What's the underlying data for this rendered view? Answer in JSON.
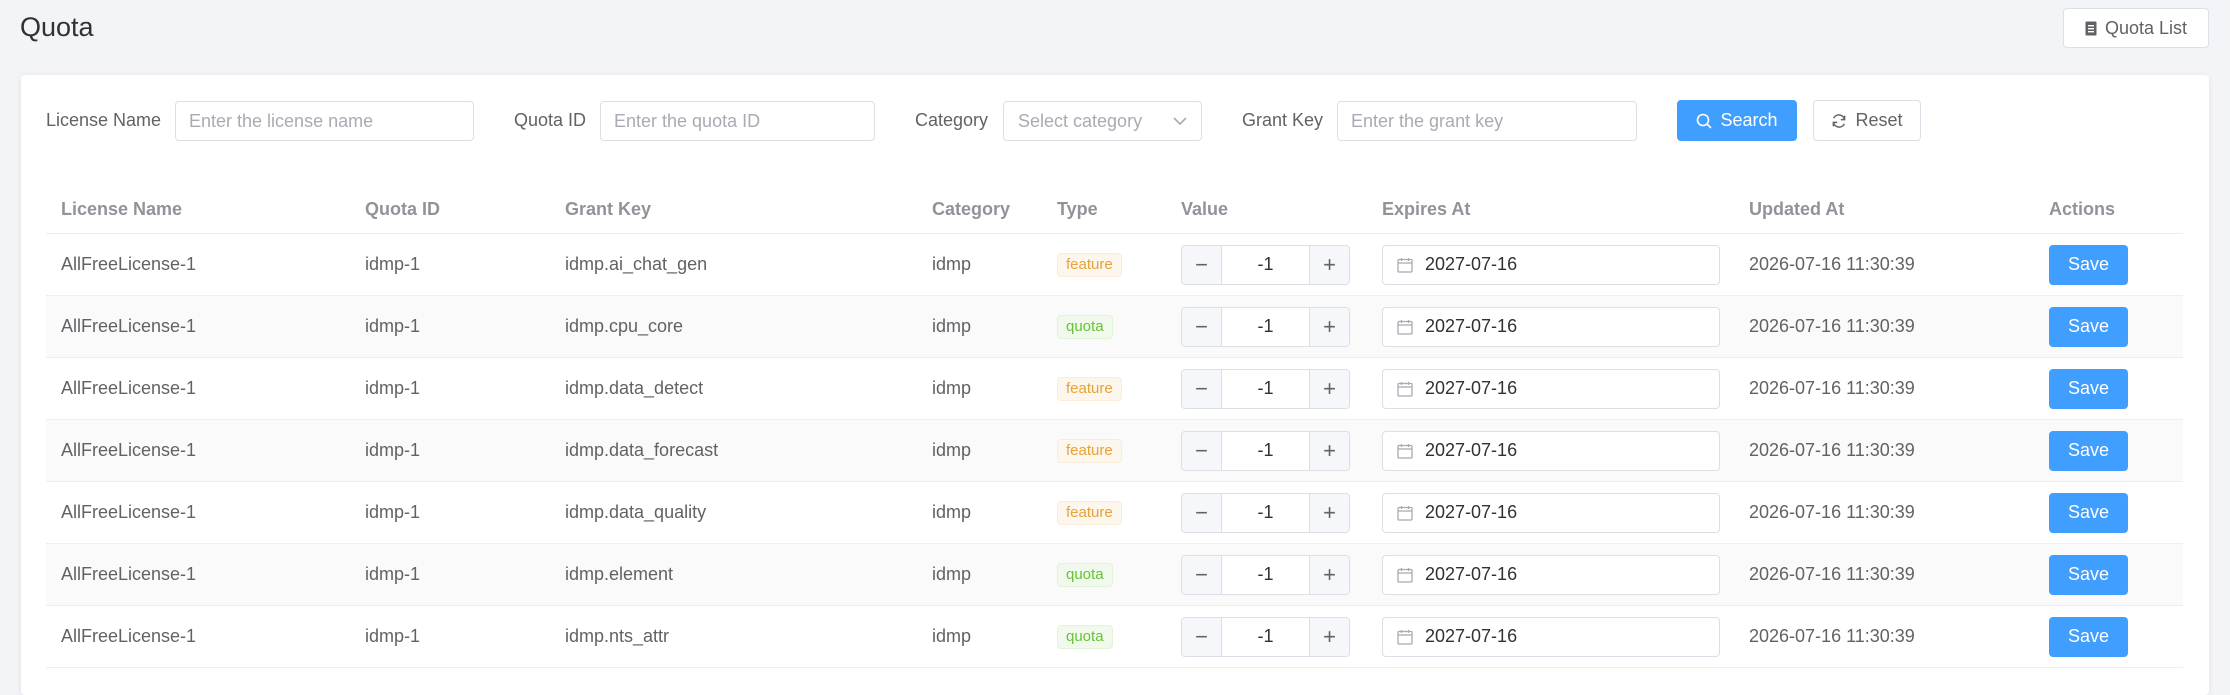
{
  "page": {
    "title": "Quota"
  },
  "header": {
    "quota_list_label": "Quota List"
  },
  "filters": {
    "license_name": {
      "label": "License Name",
      "placeholder": "Enter the license name"
    },
    "quota_id": {
      "label": "Quota ID",
      "placeholder": "Enter the quota ID"
    },
    "category": {
      "label": "Category",
      "placeholder": "Select category"
    },
    "grant_key": {
      "label": "Grant Key",
      "placeholder": "Enter the grant key"
    },
    "search_label": "Search",
    "reset_label": "Reset"
  },
  "table": {
    "headers": [
      "License Name",
      "Quota ID",
      "Grant Key",
      "Category",
      "Type",
      "Value",
      "Expires At",
      "Updated At",
      "Actions"
    ],
    "rows": [
      {
        "license_name": "AllFreeLicense-1",
        "quota_id": "idmp-1",
        "grant_key": "idmp.ai_chat_gen",
        "category": "idmp",
        "type": "feature",
        "value": "-1",
        "expires_at": "2027-07-16",
        "updated_at": "2026-07-16 11:30:39",
        "action": "Save"
      },
      {
        "license_name": "AllFreeLicense-1",
        "quota_id": "idmp-1",
        "grant_key": "idmp.cpu_core",
        "category": "idmp",
        "type": "quota",
        "value": "-1",
        "expires_at": "2027-07-16",
        "updated_at": "2026-07-16 11:30:39",
        "action": "Save"
      },
      {
        "license_name": "AllFreeLicense-1",
        "quota_id": "idmp-1",
        "grant_key": "idmp.data_detect",
        "category": "idmp",
        "type": "feature",
        "value": "-1",
        "expires_at": "2027-07-16",
        "updated_at": "2026-07-16 11:30:39",
        "action": "Save"
      },
      {
        "license_name": "AllFreeLicense-1",
        "quota_id": "idmp-1",
        "grant_key": "idmp.data_forecast",
        "category": "idmp",
        "type": "feature",
        "value": "-1",
        "expires_at": "2027-07-16",
        "updated_at": "2026-07-16 11:30:39",
        "action": "Save"
      },
      {
        "license_name": "AllFreeLicense-1",
        "quota_id": "idmp-1",
        "grant_key": "idmp.data_quality",
        "category": "idmp",
        "type": "feature",
        "value": "-1",
        "expires_at": "2027-07-16",
        "updated_at": "2026-07-16 11:30:39",
        "action": "Save"
      },
      {
        "license_name": "AllFreeLicense-1",
        "quota_id": "idmp-1",
        "grant_key": "idmp.element",
        "category": "idmp",
        "type": "quota",
        "value": "-1",
        "expires_at": "2027-07-16",
        "updated_at": "2026-07-16 11:30:39",
        "action": "Save"
      },
      {
        "license_name": "AllFreeLicense-1",
        "quota_id": "idmp-1",
        "grant_key": "idmp.nts_attr",
        "category": "idmp",
        "type": "quota",
        "value": "-1",
        "expires_at": "2027-07-16",
        "updated_at": "2026-07-16 11:30:39",
        "action": "Save"
      }
    ]
  },
  "icons": {
    "quota_list": "document-icon",
    "search": "search-icon",
    "reset": "refresh-icon",
    "select": "chevron-down-icon",
    "date": "calendar-icon",
    "minus": "minus-icon",
    "plus": "plus-icon"
  },
  "colors": {
    "primary": "#409eff",
    "feature_tag": "#e6a23c",
    "quota_tag": "#67c23a"
  }
}
